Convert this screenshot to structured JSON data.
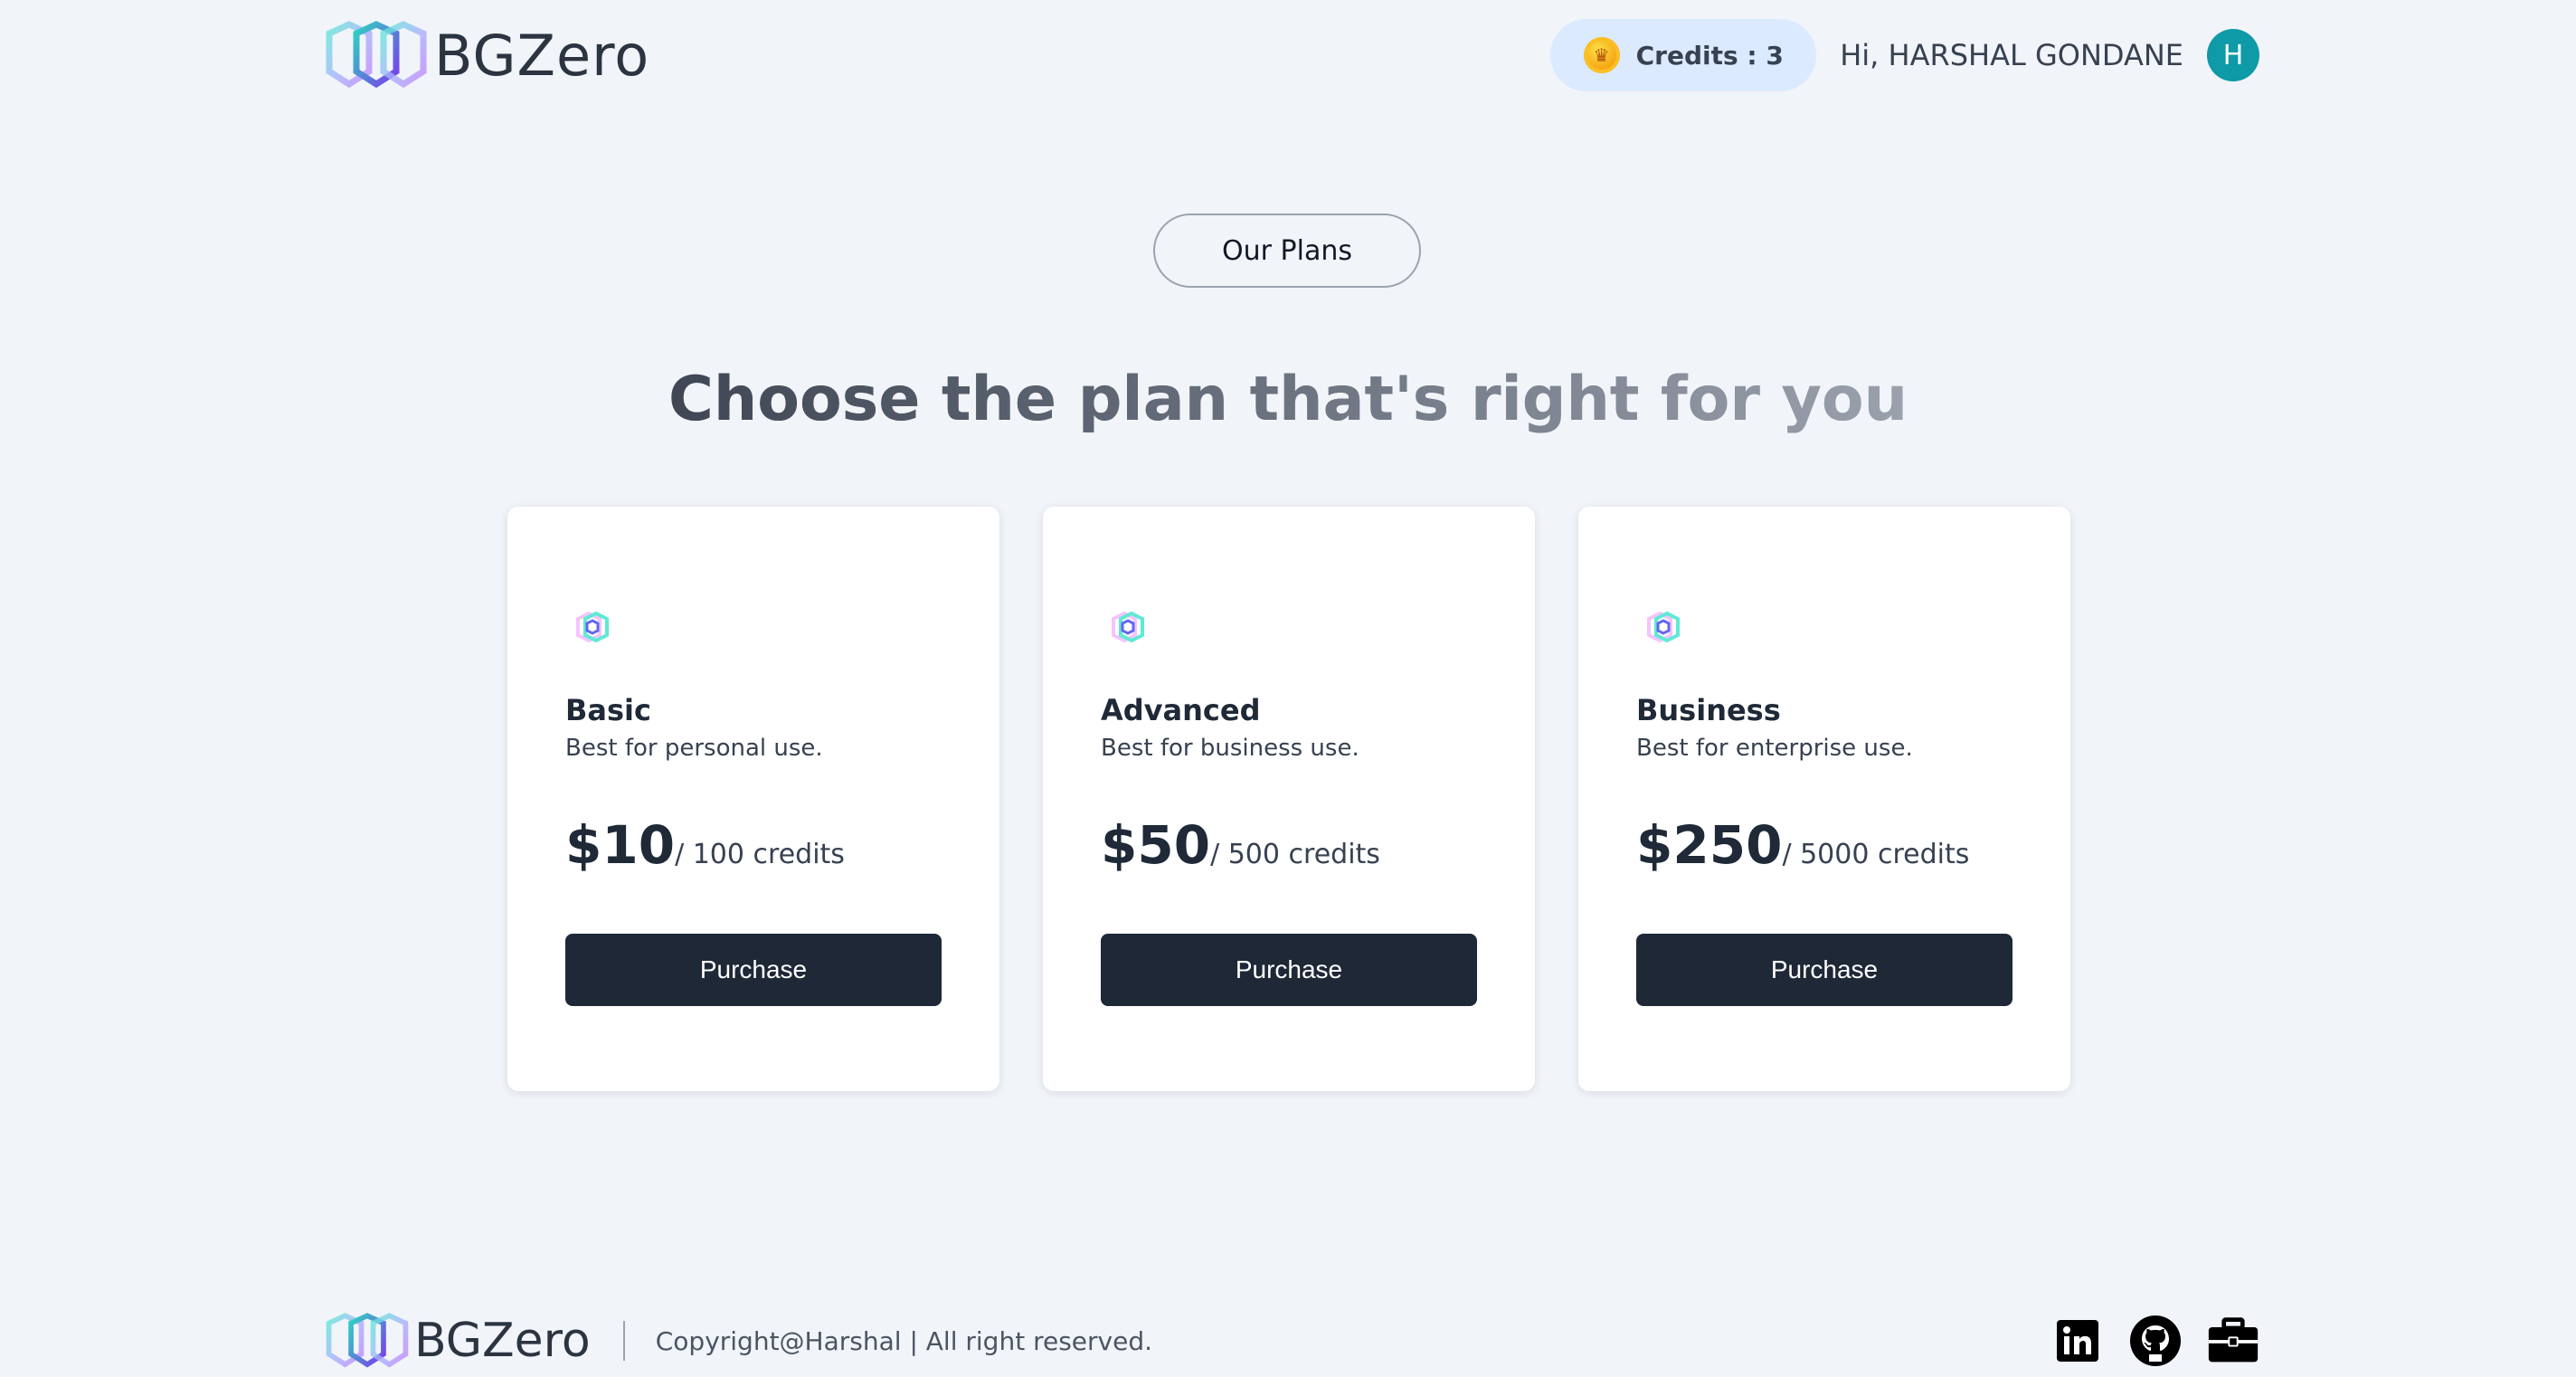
{
  "header": {
    "logo_text": "BGZero",
    "credits_label": "Credits : 3",
    "greeting": "Hi, HARSHAL GONDANE",
    "avatar_initial": "H"
  },
  "main": {
    "badge": "Our Plans",
    "headline": "Choose the plan that's right for you",
    "plans": [
      {
        "name": "Basic",
        "description": "Best for personal use.",
        "price": "$10",
        "unit": "/ 100 credits",
        "button": "Purchase"
      },
      {
        "name": "Advanced",
        "description": "Best for business use.",
        "price": "$50",
        "unit": "/ 500 credits",
        "button": "Purchase"
      },
      {
        "name": "Business",
        "description": "Best for enterprise use.",
        "price": "$250",
        "unit": "/ 5000 credits",
        "button": "Purchase"
      }
    ]
  },
  "footer": {
    "logo_text": "BGZero",
    "copyright": "Copyright@Harshal | All right reserved.",
    "socials": [
      "linkedin-icon",
      "github-icon",
      "briefcase-icon"
    ]
  },
  "colors": {
    "background": "#f1f4f9",
    "credits_pill": "#dbeafe",
    "button": "#1e2837",
    "avatar": "#0e9aa7"
  }
}
